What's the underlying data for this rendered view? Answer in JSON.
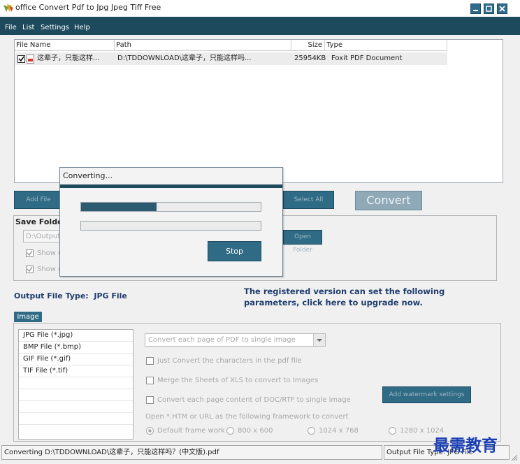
{
  "window": {
    "title": "office Convert Pdf to Jpg Jpeg Tiff Free"
  },
  "menu": [
    "File",
    "List",
    "Settings",
    "Help"
  ],
  "file_list": {
    "columns": [
      "File Name",
      "Path",
      "Size",
      "Type"
    ],
    "rows": [
      {
        "checked": true,
        "name": "这辈子，只能这样...",
        "path": "D:\\TDDOWNLOAD\\这辈子，只能这样吗...",
        "size": "25954KB",
        "type": "Foxit PDF Document"
      }
    ]
  },
  "buttons": {
    "add_file": "Add File",
    "select_all": "Select All",
    "convert": "Convert",
    "open_folder": "Open Folder"
  },
  "save_folder": {
    "title": "Save Folder",
    "path": "D:\\Output",
    "show_option_1": "Show c",
    "show_option_2": "Show c"
  },
  "output_type": {
    "label": "Output File Type:",
    "value": "JPG File"
  },
  "registered_msg": {
    "line1": "The registered version can set the following",
    "line2": "parameters, click here to upgrade now."
  },
  "image_tab": {
    "tab_label": "Image",
    "formats": [
      "JPG File  (*.jpg)",
      "BMP File  (*.bmp)",
      "GIF File  (*.gif)",
      "TIF File  (*.tif)"
    ],
    "convert_mode": "Convert each page of PDF to single image",
    "options": [
      "Just Convert the characters in the pdf file",
      "Merge the Sheets of XLS to convert to Images",
      "Convert each page content of DOC/RTF to single image"
    ],
    "watermark_button": "Add watermark settings",
    "open_htm_label": "Open *.HTM or URL as the following framework to convert",
    "frame_options": [
      "Default frame work",
      "800 x 600",
      "1024 x 768",
      "1280 x 1024"
    ]
  },
  "status": {
    "left": "Converting  D:\\TDDOWNLOAD\\这辈子，只能这样吗？(中文版).pdf",
    "right": "Output File Type:  JPG File"
  },
  "watermark_text": "最需教育",
  "dialog": {
    "title": "Converting...",
    "progress_1": 0.42,
    "progress_2": 0,
    "stop_label": "Stop"
  },
  "colors": {
    "menubar": "#1e4a5e",
    "accent": "#2f6b85",
    "message_text": "#1f3d6e",
    "watermark": "#1a3fb5"
  }
}
